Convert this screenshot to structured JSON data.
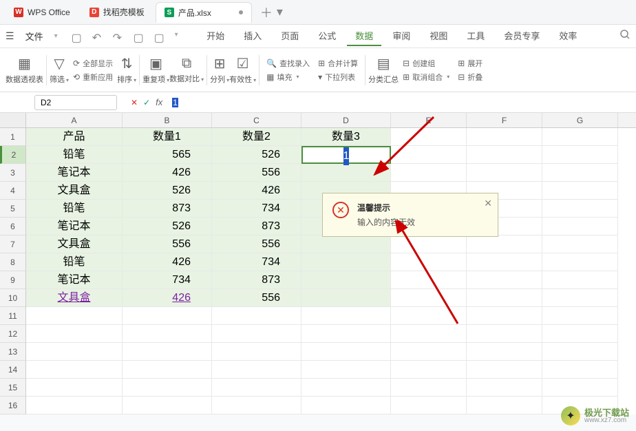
{
  "app": {
    "name": "WPS Office"
  },
  "tabs": [
    {
      "label": "WPS Office",
      "icon": "W"
    },
    {
      "label": "找稻壳模板",
      "icon": "D"
    },
    {
      "label": "产品.xlsx",
      "icon": "S"
    }
  ],
  "menu": {
    "file": "文件",
    "items": [
      "开始",
      "插入",
      "页面",
      "公式",
      "数据",
      "审阅",
      "视图",
      "工具",
      "会员专享",
      "效率"
    ],
    "active": "数据"
  },
  "ribbon": {
    "pivot": "数据透视表",
    "filter": "筛选",
    "showall": "全部显示",
    "reapply": "重新应用",
    "sort": "排序",
    "dup": "重复项",
    "compare": "数据对比",
    "split": "分列",
    "valid": "有效性",
    "lookup": "查找录入",
    "consol": "合并计算",
    "fill": "填充",
    "dropdown": "下拉列表",
    "subtotal": "分类汇总",
    "group": "创建组",
    "ungroup": "取消组合",
    "expand": "展开",
    "collapse": "折叠"
  },
  "namebox": "D2",
  "formula_value": "1",
  "headers": [
    "A",
    "B",
    "C",
    "D",
    "E",
    "F",
    "G"
  ],
  "rows": [
    "1",
    "2",
    "3",
    "4",
    "5",
    "6",
    "7",
    "8",
    "9",
    "10",
    "11",
    "12",
    "13",
    "14",
    "15",
    "16"
  ],
  "table": {
    "h": [
      "产品",
      "数量1",
      "数量2",
      "数量3"
    ],
    "r": [
      [
        "铅笔",
        "565",
        "526"
      ],
      [
        "笔记本",
        "426",
        "556"
      ],
      [
        "文具盒",
        "526",
        "426"
      ],
      [
        "铅笔",
        "873",
        "734"
      ],
      [
        "笔记本",
        "526",
        "873"
      ],
      [
        "文具盒",
        "556",
        "556"
      ],
      [
        "铅笔",
        "426",
        "734"
      ],
      [
        "笔记本",
        "734",
        "873"
      ],
      [
        "文具盒",
        "426",
        "556"
      ]
    ]
  },
  "active_cell_value": "1",
  "tooltip": {
    "title": "温馨提示",
    "desc": "输入的内容无效"
  },
  "watermark": {
    "cn": "极光下载站",
    "en": "www.xz7.com"
  }
}
